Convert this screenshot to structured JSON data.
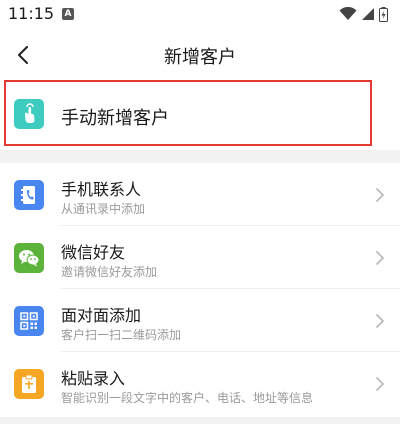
{
  "status_bar": {
    "time": "11:15",
    "notification_badge": "A"
  },
  "header": {
    "title": "新增客户"
  },
  "manual_add": {
    "label": "手动新增客户",
    "accent": "#3ecbc0",
    "icon": "touch-icon"
  },
  "options": [
    {
      "title": "手机联系人",
      "subtitle": "从通讯录中添加",
      "icon": "contacts-book-icon",
      "color": "#4a86f0"
    },
    {
      "title": "微信好友",
      "subtitle": "邀请微信好友添加",
      "icon": "wechat-icon",
      "color": "#5bb33c"
    },
    {
      "title": "面对面添加",
      "subtitle": "客户扫一扫二维码添加",
      "icon": "qr-code-icon",
      "color": "#4a86f0"
    },
    {
      "title": "粘贴录入",
      "subtitle": "智能识别一段文字中的客户、电话、地址等信息",
      "icon": "paste-icon",
      "color": "#f5a623"
    }
  ],
  "colors": {
    "highlight_border": "#e53935",
    "background": "#f2f2f2"
  }
}
